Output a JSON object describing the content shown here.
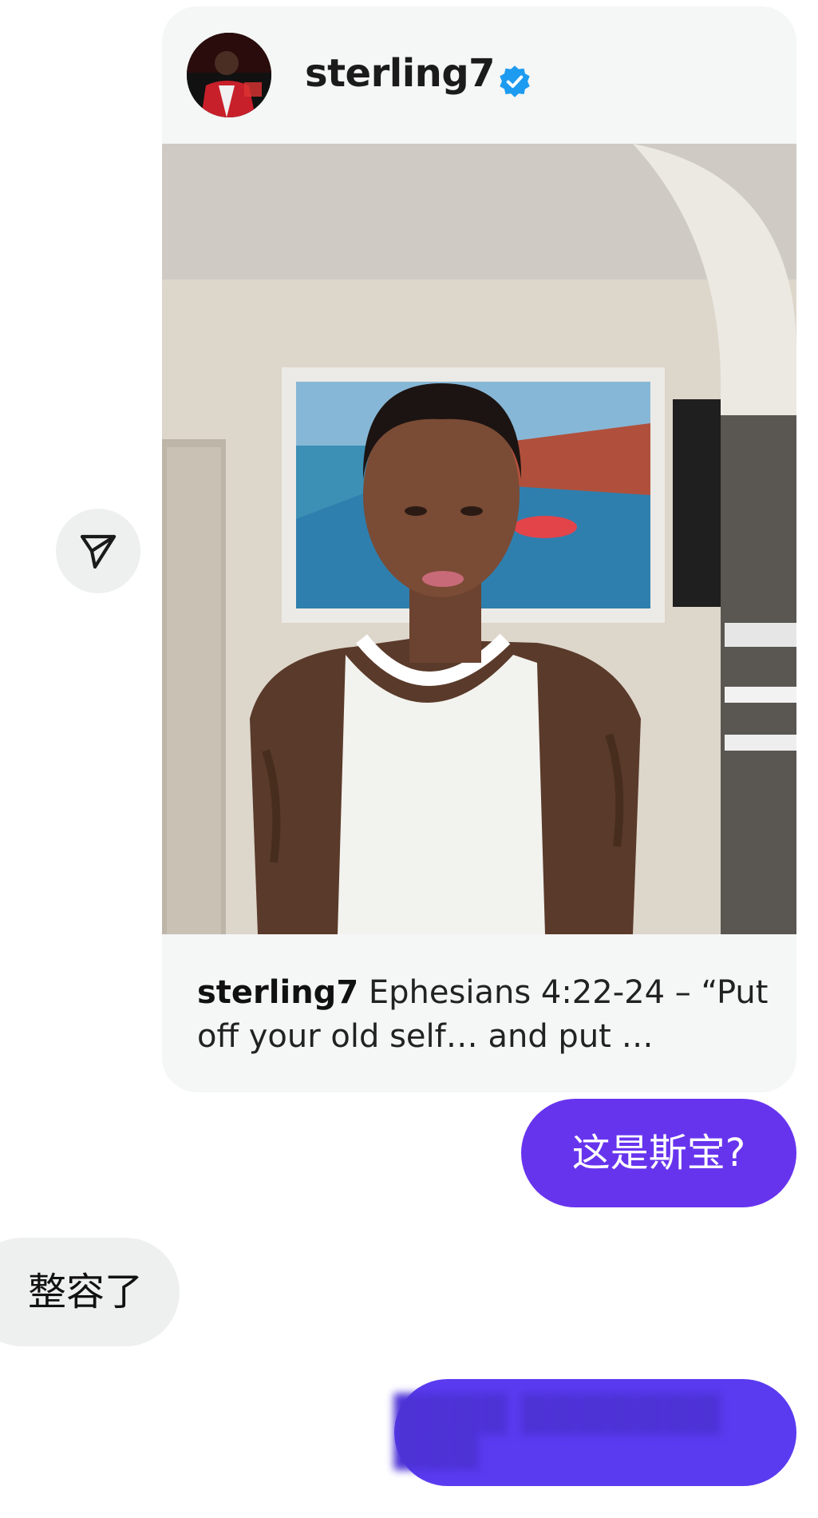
{
  "post": {
    "username": "sterling7",
    "verified": true,
    "caption_user": "sterling7",
    "caption_text": " Ephesians 4:22-24 – “Put off your old self… and put …"
  },
  "messages": [
    {
      "direction": "outgoing",
      "text": "这是斯宝?"
    },
    {
      "direction": "incoming",
      "text": "整容了"
    },
    {
      "direction": "outgoing",
      "text": "████ ███████ ███",
      "blurred": true
    }
  ],
  "icons": {
    "share": "paper-plane-icon",
    "verified": "verified-badge-icon"
  },
  "colors": {
    "outgoing_bubble": "#6734ee",
    "incoming_bubble": "#eeefef",
    "verified_blue": "#1d9bf0",
    "card_background": "#f5f6f6"
  }
}
